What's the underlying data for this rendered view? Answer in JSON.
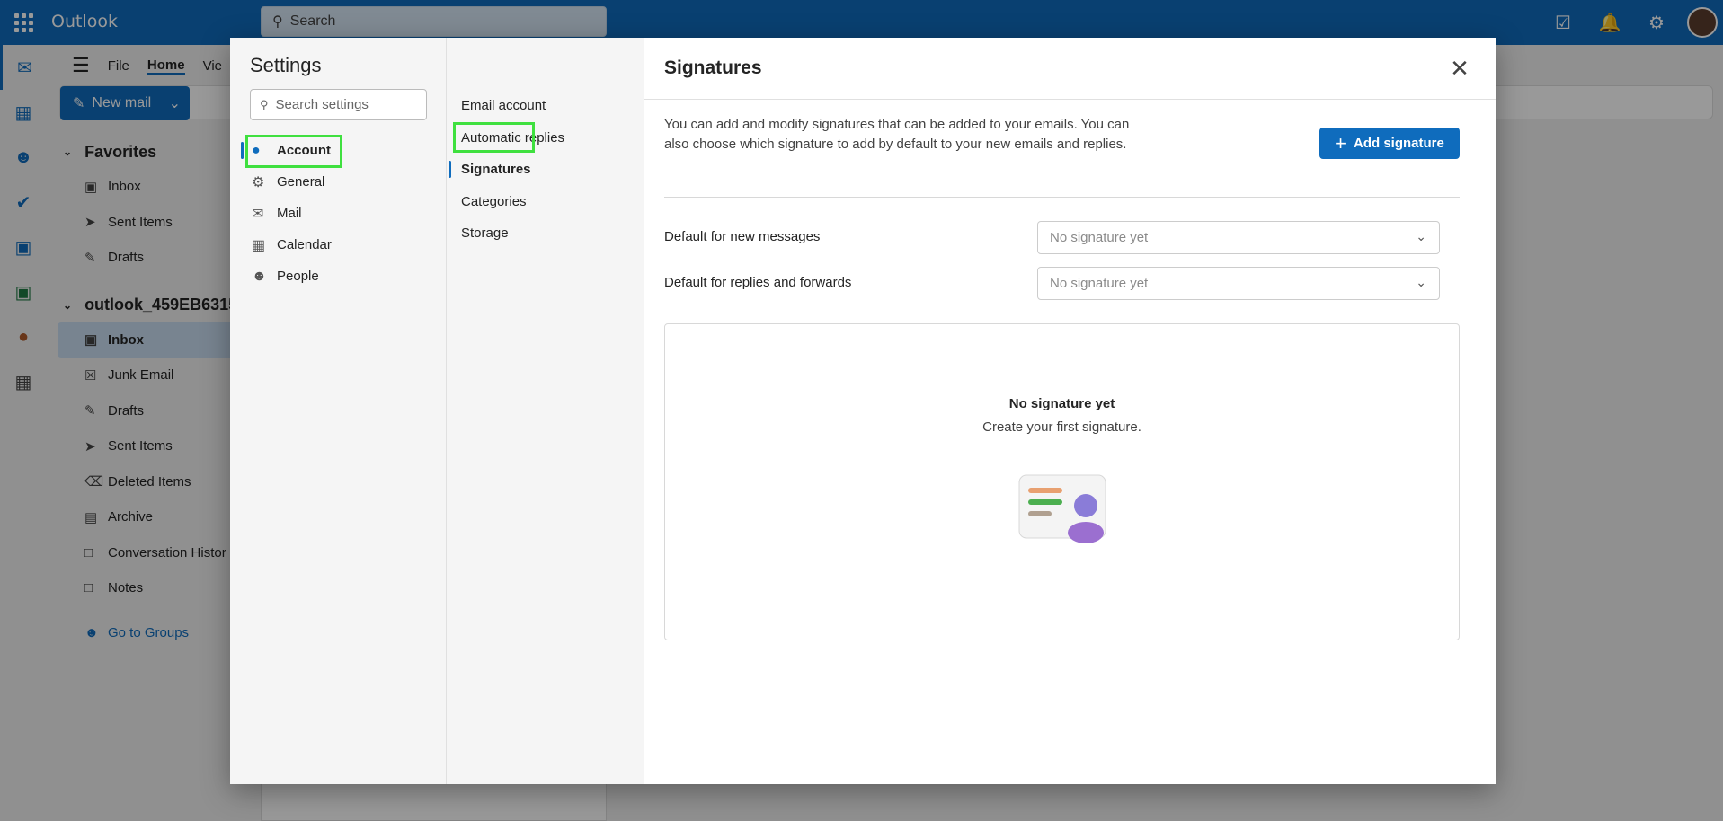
{
  "app": {
    "title": "Outlook",
    "search_placeholder": "Search"
  },
  "ribbon": {
    "tabs": [
      "File",
      "Home",
      "Vie"
    ],
    "new_mail": "New mail"
  },
  "folders": {
    "favorites_label": "Favorites",
    "favorites": [
      {
        "label": "Inbox",
        "icon": "inbox-icon"
      },
      {
        "label": "Sent Items",
        "icon": "send-icon"
      },
      {
        "label": "Drafts",
        "icon": "pencil-icon"
      }
    ],
    "account_label": "outlook_459EB6315...",
    "account_folders": [
      {
        "label": "Inbox",
        "icon": "inbox-icon"
      },
      {
        "label": "Junk Email",
        "icon": "junk-icon"
      },
      {
        "label": "Drafts",
        "icon": "pencil-icon"
      },
      {
        "label": "Sent Items",
        "icon": "send-icon"
      },
      {
        "label": "Deleted Items",
        "icon": "trash-icon"
      },
      {
        "label": "Archive",
        "icon": "archive-icon"
      },
      {
        "label": "Conversation Histor",
        "icon": "folder-icon"
      },
      {
        "label": "Notes",
        "icon": "note-icon"
      }
    ],
    "groups_link": "Go to Groups"
  },
  "settings": {
    "title": "Settings",
    "search_placeholder": "Search settings",
    "categories": [
      {
        "label": "Account",
        "icon": "person-icon"
      },
      {
        "label": "General",
        "icon": "gear-icon"
      },
      {
        "label": "Mail",
        "icon": "mail-icon"
      },
      {
        "label": "Calendar",
        "icon": "calendar-icon"
      },
      {
        "label": "People",
        "icon": "people-icon"
      }
    ],
    "subcategories": [
      "Email account",
      "Automatic replies",
      "Signatures",
      "Categories",
      "Storage"
    ]
  },
  "signatures": {
    "title": "Signatures",
    "description": "You can add and modify signatures that can be added to your emails. You can also choose which signature to add by default to your new emails and replies.",
    "add_button": "Add signature",
    "default_new_label": "Default for new messages",
    "default_new_value": "No signature yet",
    "default_reply_label": "Default for replies and forwards",
    "default_reply_value": "No signature yet",
    "empty_title": "No signature yet",
    "empty_subtitle": "Create your first signature."
  },
  "colors": {
    "accent": "#0f6cbd",
    "highlight": "#3fe03f"
  }
}
